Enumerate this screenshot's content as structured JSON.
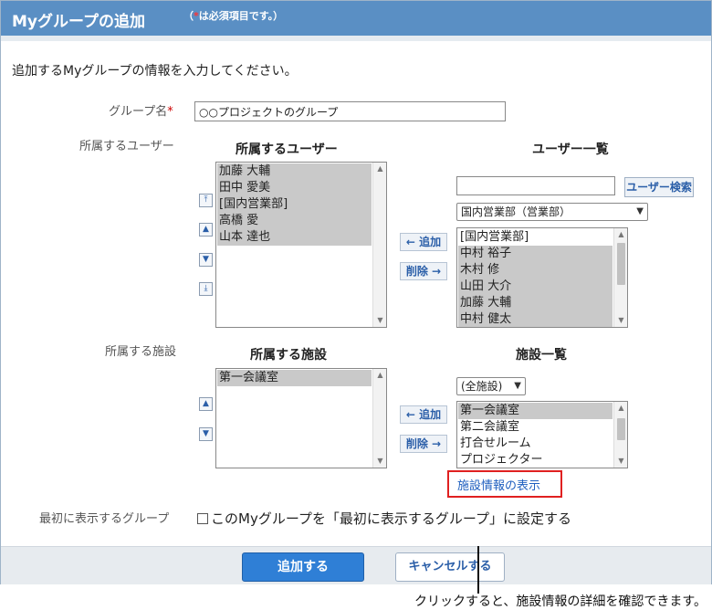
{
  "header": {
    "title": "Myグループの追加",
    "required_note_star": "*",
    "required_note": "は必須項目です。）",
    "required_note_open": "（"
  },
  "intro": "追加するMyグループの情報を入力してください。",
  "group_name": {
    "label": "グループ名",
    "required_mark": "*",
    "value": "○○プロジェクトのグループ"
  },
  "members_section": {
    "label": "所属するユーザー",
    "left_heading": "所属するユーザー",
    "right_heading": "ユーザー一覧",
    "members": [
      "加藤 大輔",
      "田中 愛美",
      "[国内営業部]",
      "高橋 愛",
      "山本 達也"
    ],
    "search_value": "",
    "search_button": "ユーザー検索",
    "department_select": "国内営業部（営業部）",
    "candidates": [
      "[国内営業部]",
      "中村 裕子",
      "木村 修",
      "山田 大介",
      "加藤 大輔",
      "中村 健太"
    ],
    "add_button": "← 追加",
    "remove_button": "削除 →"
  },
  "facilities_section": {
    "label": "所属する施設",
    "left_heading": "所属する施設",
    "right_heading": "施設一覧",
    "selected": [
      "第一会議室"
    ],
    "filter_select": "(全施設)",
    "candidates": [
      "第一会議室",
      "第二会議室",
      "打合せルーム",
      "プロジェクター"
    ],
    "add_button": "← 追加",
    "remove_button": "削除 →",
    "info_link": "施設情報の表示"
  },
  "default_group": {
    "label": "最初に表示するグループ",
    "checkbox_label": "このMyグループを「最初に表示するグループ」に設定する",
    "checked": false
  },
  "footer": {
    "submit": "追加する",
    "cancel": "キャンセルする"
  },
  "callout": "クリックすると、施設情報の詳細を確認できます。",
  "colors": {
    "title_bar": "#5a8fc4",
    "primary_button": "#2f7fd6",
    "link": "#1f5fbf",
    "highlight_box": "#e02020"
  }
}
